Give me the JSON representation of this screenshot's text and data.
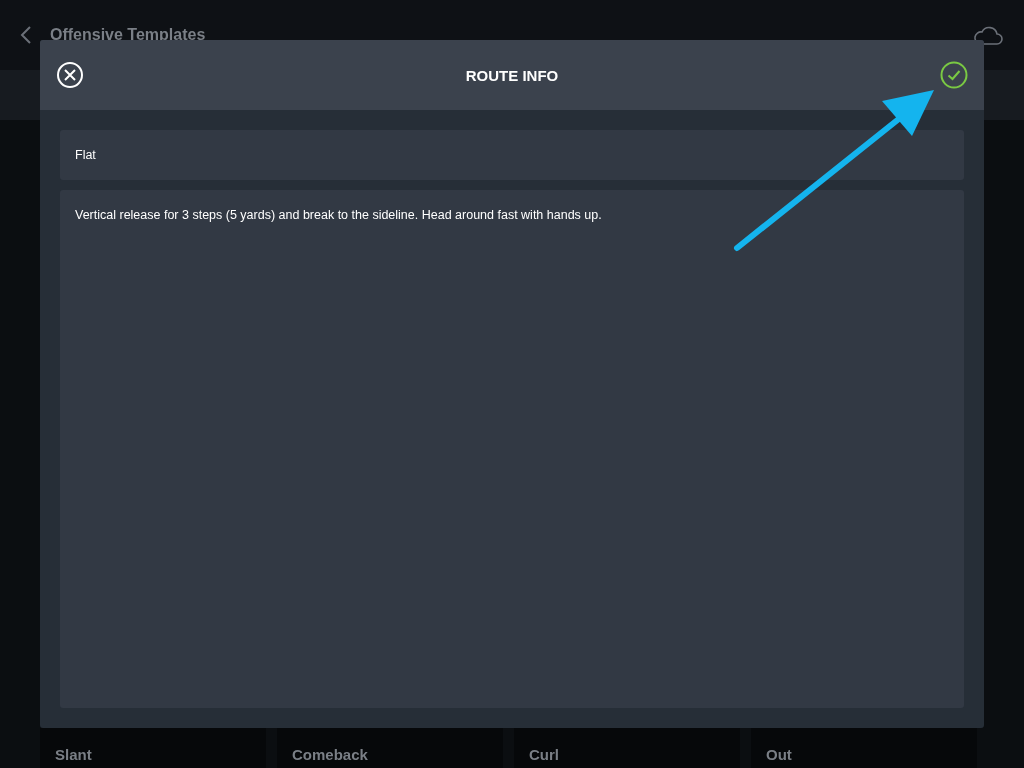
{
  "header": {
    "title": "Offensive Templates"
  },
  "dialog": {
    "title": "ROUTE INFO",
    "name_field": {
      "value": "Flat"
    },
    "description_field": {
      "value": "Vertical release for 3 steps (5 yards) and break to the sideline. Head around fast with hands up."
    }
  },
  "route_cards": [
    {
      "label": "Slant"
    },
    {
      "label": "Comeback"
    },
    {
      "label": "Curl"
    },
    {
      "label": "Out"
    }
  ]
}
